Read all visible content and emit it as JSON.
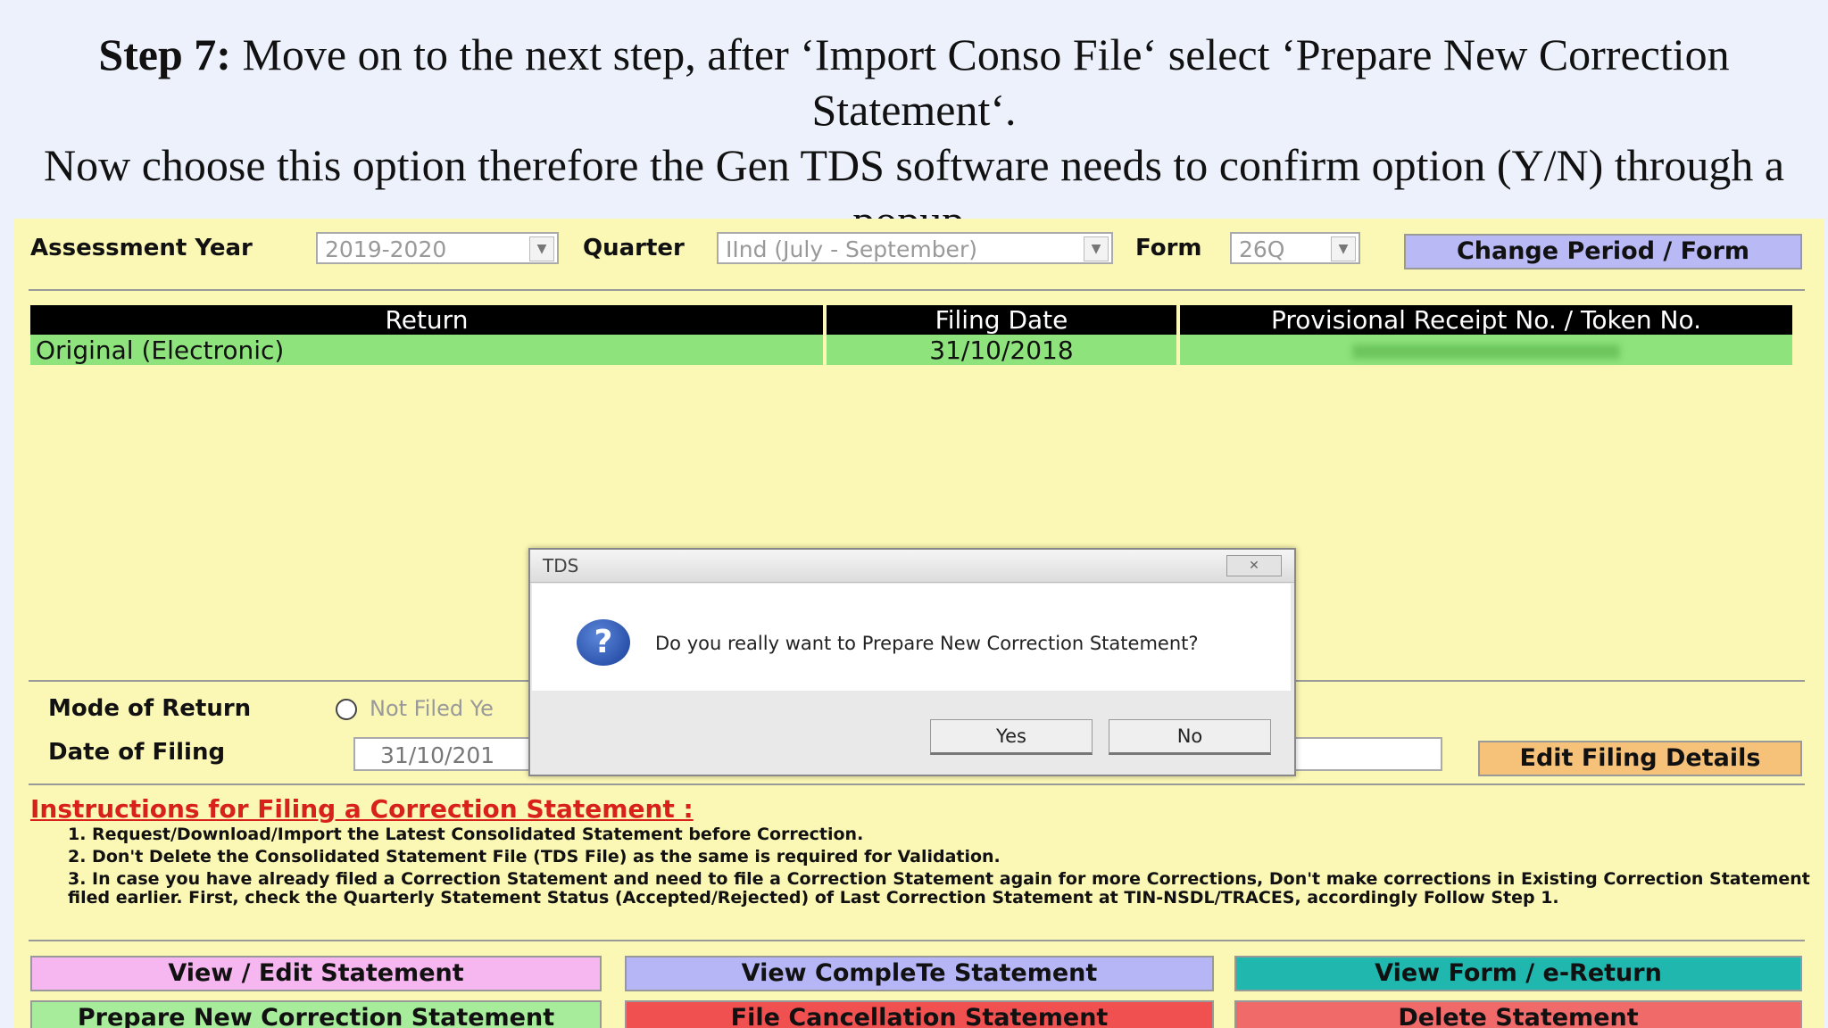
{
  "caption": {
    "step": "Step 7:",
    "text_before": " Move on to the next step, after ‘Import Conso File‘ select ‘Prepare New Correction Statement‘.",
    "line2": "Now choose this option therefore the Gen TDS software needs to confirm option (Y/N) through a",
    "line3": "popup."
  },
  "form": {
    "assessment_year_label": "Assessment Year",
    "assessment_year_value": "2019-2020",
    "quarter_label": "Quarter",
    "quarter_value": "IInd (July - September)",
    "form_label": "Form",
    "form_value": "26Q",
    "change_period_button": "Change Period / Form"
  },
  "grid": {
    "headers": [
      "Return",
      "Filing Date",
      "Provisional Receipt No. / Token No."
    ],
    "rows": [
      [
        "Original (Electronic)",
        "31/10/2018",
        ""
      ]
    ]
  },
  "filing": {
    "mode_label": "Mode of Return",
    "mode_option": "Not Filed Ye",
    "date_label": "Date of Filing",
    "date_value": "31/10/201",
    "edit_button": "Edit Filing Details"
  },
  "instructions": {
    "title": "Instructions for Filing a Correction Statement :",
    "items": [
      "1. Request/Download/Import the Latest Consolidated Statement before Correction.",
      "2. Don't Delete the Consolidated Statement File (TDS File) as the same is required for Validation.",
      "3. In case you have already filed a Correction Statement and need to file a Correction Statement again for more Corrections, Don't make corrections in Existing Correction Statement filed earlier. First, check the Quarterly Statement Status (Accepted/Rejected) of Last Correction Statement at TIN-NSDL/TRACES, accordingly Follow Step 1."
    ]
  },
  "actions": {
    "view_edit": "View / Edit Statement",
    "view_complete": "View CompleTe Statement",
    "view_form": "View Form / e-Return",
    "prepare_new": "Prepare New Correction Statement",
    "file_cancellation": "File Cancellation Statement",
    "delete": "Delete Statement"
  },
  "dialog": {
    "title": "TDS",
    "icon": "question-icon",
    "message": "Do you really want to Prepare New Correction Statement?",
    "yes": "Yes",
    "no": "No"
  },
  "colors": {
    "app_bg": "#fbf7b4",
    "row_green": "#8fe37d",
    "change_btn": "#b9b9f6",
    "edit_btn": "#f6c27a",
    "view_edit_btn": "#f6b6ef",
    "view_complete_btn": "#b6b6f6",
    "view_form_btn": "#1fb7ae",
    "prepare_btn": "#a6ec9a",
    "cancel_btn": "#f05050",
    "delete_btn": "#f06a6a",
    "instr_title": "#d8211a"
  }
}
